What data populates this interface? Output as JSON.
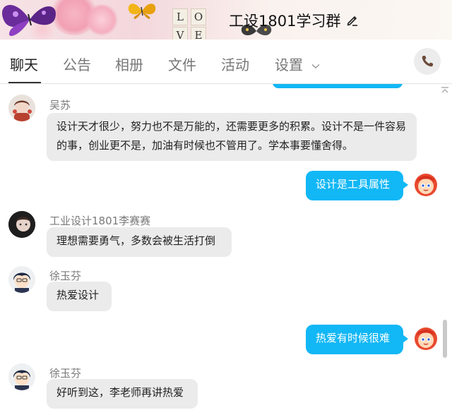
{
  "header": {
    "title": "工设1801学习群",
    "edit_icon": "pencil-icon",
    "banner_tiles": [
      "L",
      "O",
      "V",
      "E"
    ]
  },
  "tabs": [
    {
      "label": "聊天",
      "active": true
    },
    {
      "label": "公告",
      "active": false
    },
    {
      "label": "相册",
      "active": false
    },
    {
      "label": "文件",
      "active": false
    },
    {
      "label": "活动",
      "active": false
    },
    {
      "label": "设置",
      "active": false,
      "has_dropdown": true
    }
  ],
  "call_button_icon": "phone-icon",
  "colors": {
    "outgoing_bubble": "#12b7f5",
    "incoming_bubble": "#ebebeb"
  },
  "messages": [
    {
      "direction": "in",
      "sender": "吴苏",
      "text": "设计天才很少，努力也不是万能的，还需要更多的积累。设计不是一件容易的事，创业更不是，加油有时候也不管用了。学本事要懂舍得。"
    },
    {
      "direction": "out",
      "text": "设计是工具属性"
    },
    {
      "direction": "in",
      "sender": "工业设计1801李赛赛",
      "text": "理想需要勇气，多数会被生活打倒"
    },
    {
      "direction": "in",
      "sender": "徐玉芬",
      "text": "热爱设计"
    },
    {
      "direction": "out",
      "text": "热爱有时候很难"
    },
    {
      "direction": "in",
      "sender": "徐玉芬",
      "text": "好听到这，李老师再讲热爱"
    }
  ]
}
